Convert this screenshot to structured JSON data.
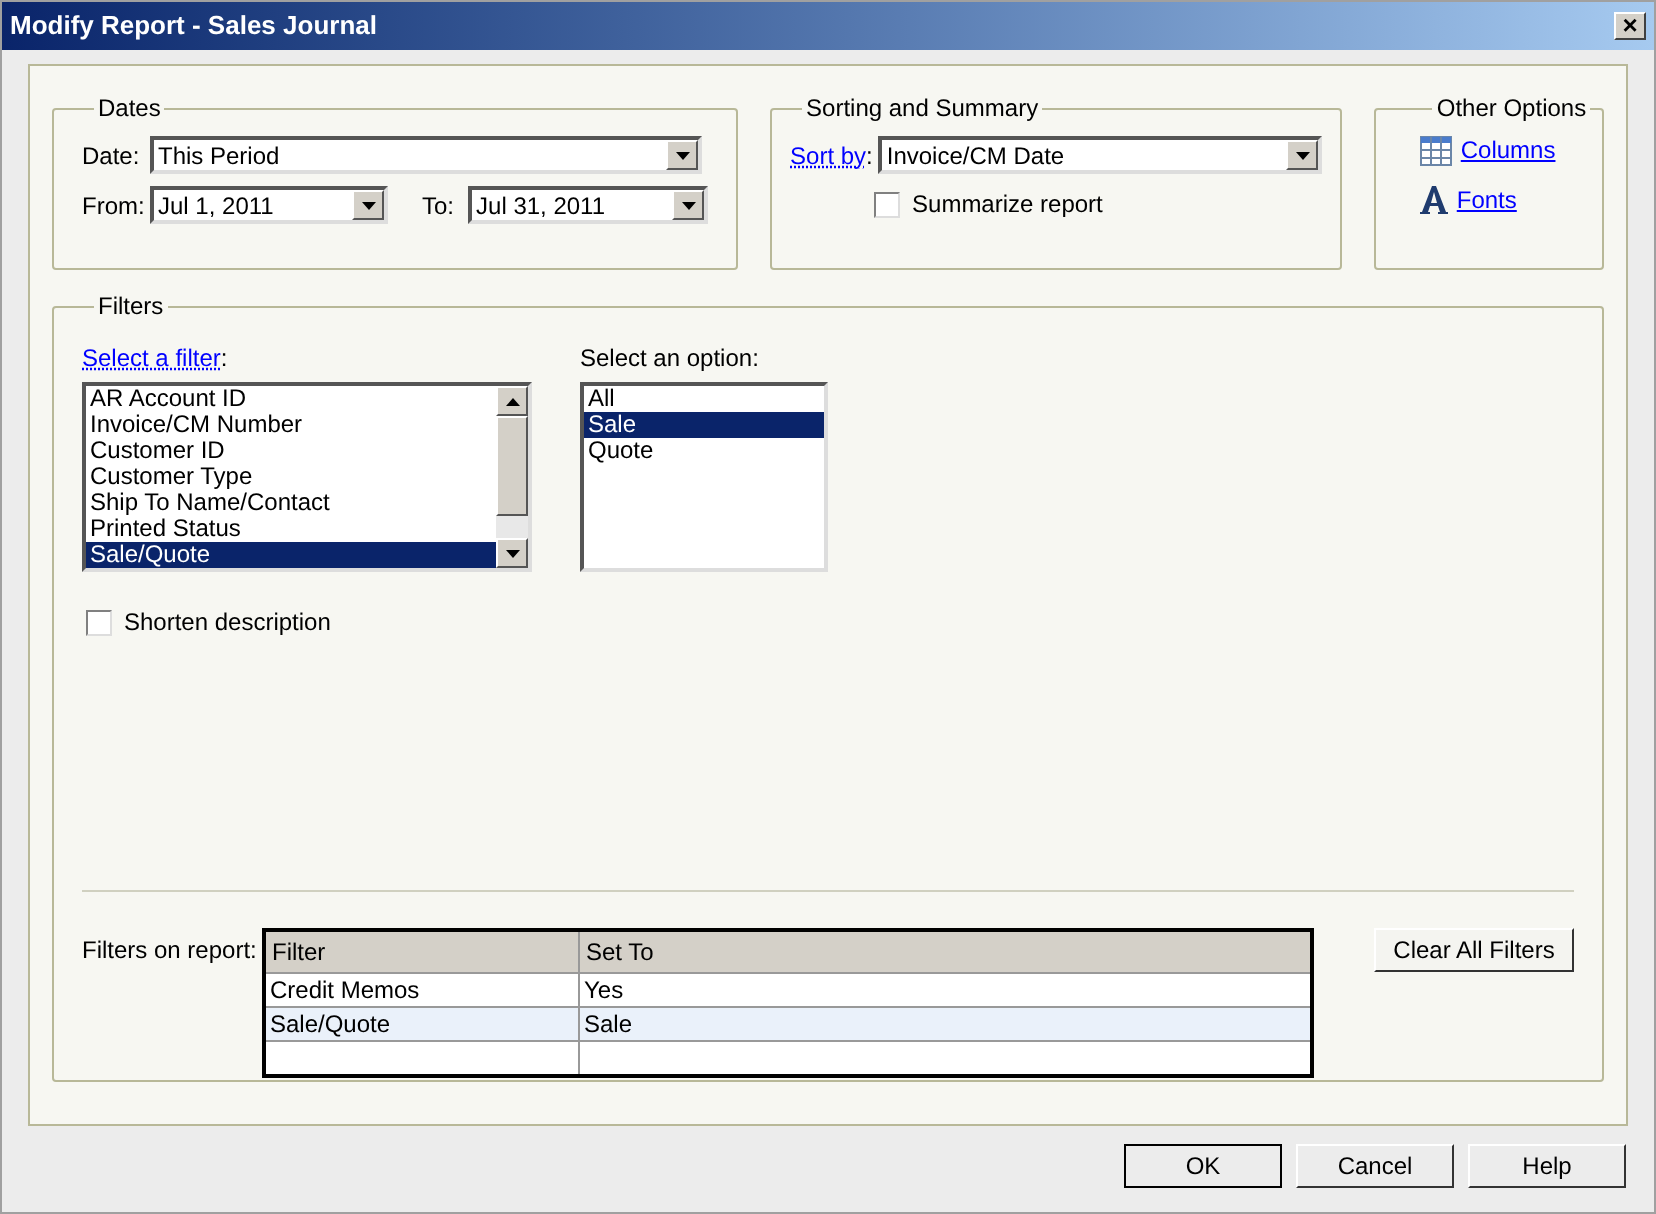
{
  "window": {
    "title": "Modify Report - Sales Journal",
    "close": "×"
  },
  "dates": {
    "title": "Dates",
    "date_label": "Date:",
    "date_value": "This Period",
    "from_label": "From:",
    "from_value": "Jul 1, 2011",
    "to_label": "To:",
    "to_value": "Jul 31, 2011"
  },
  "sorting": {
    "title": "Sorting and Summary",
    "sort_label": "Sort by",
    "sort_colon": ":",
    "sort_value": "Invoice/CM Date",
    "summarize": {
      "label": "Summarize report",
      "checked": false
    }
  },
  "other_options": {
    "title": "Other Options",
    "links": [
      {
        "kind": "columns",
        "label": "Columns"
      },
      {
        "kind": "fonts",
        "label": "Fonts"
      }
    ]
  },
  "filters": {
    "title": "Filters",
    "select_filter_label": "Select a filter",
    "select_filter_colon": ":",
    "filter_items": [
      {
        "label": "AR Account ID",
        "selected": false
      },
      {
        "label": "Invoice/CM Number",
        "selected": false
      },
      {
        "label": "Customer ID",
        "selected": false
      },
      {
        "label": "Customer Type",
        "selected": false
      },
      {
        "label": "Ship To Name/Contact",
        "selected": false
      },
      {
        "label": "Printed Status",
        "selected": false
      },
      {
        "label": "Sale/Quote",
        "selected": true
      }
    ],
    "option_label": "Select an option:",
    "options": [
      {
        "label": "All",
        "selected": false
      },
      {
        "label": "Sale",
        "selected": true
      },
      {
        "label": "Quote",
        "selected": false
      }
    ],
    "shorten": {
      "label": "Shorten description",
      "checked": false
    },
    "on_report_label": "Filters on report:",
    "table": {
      "columns": [
        "Filter",
        "Set To"
      ],
      "rows": [
        {
          "cells": [
            "Credit Memos",
            "Yes"
          ],
          "selected": false
        },
        {
          "cells": [
            "Sale/Quote",
            "Sale"
          ],
          "selected": true
        }
      ]
    },
    "clear_button": "Clear All Filters"
  },
  "buttons": [
    "OK",
    "Cancel",
    "Help"
  ]
}
